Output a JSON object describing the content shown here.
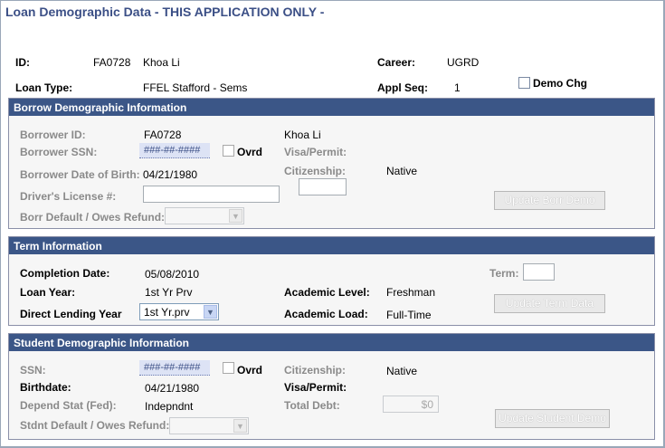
{
  "page": {
    "title": "Loan Demographic Data - THIS APPLICATION ONLY -"
  },
  "header": {
    "id_label": "ID:",
    "id_value": "FA0728",
    "name": "Khoa Li",
    "career_label": "Career:",
    "career_value": "UGRD",
    "loan_type_label": "Loan Type:",
    "loan_type_value": "FFEL Stafford - Sems",
    "appl_seq_label": "Appl Seq:",
    "appl_seq_value": "1",
    "demo_chg_label": "Demo Chg"
  },
  "borrow": {
    "header": "Borrow Demographic Information",
    "borrower_id_label": "Borrower ID:",
    "borrower_id_value": "FA0728",
    "borrower_name": "Khoa Li",
    "ssn_label": "Borrower SSN:",
    "ssn_value": "###-##-####",
    "ovrd_label": "Ovrd",
    "visa_label": "Visa/Permit:",
    "dob_label": "Borrower Date of Birth:",
    "dob_value": "04/21/1980",
    "citizenship_label": "Citizenship:",
    "citizenship_value": "Native",
    "license_label": "Driver's License #:",
    "default_label": "Borr Default / Owes Refund:",
    "update_button": "Update Borr Demo"
  },
  "term": {
    "header": "Term Information",
    "completion_label": "Completion Date:",
    "completion_value": "05/08/2010",
    "term_label": "Term:",
    "loan_year_label": "Loan Year:",
    "loan_year_value": "1st Yr Prv",
    "academic_level_label": "Academic Level:",
    "academic_level_value": "Freshman",
    "direct_lending_label": "Direct Lending Year",
    "direct_lending_value": "1st Yr.prv",
    "academic_load_label": "Academic Load:",
    "academic_load_value": "Full-Time",
    "update_button": "Update Term Data"
  },
  "student": {
    "header": "Student Demographic Information",
    "ssn_label": "SSN:",
    "ssn_value": "###-##-####",
    "ovrd_label": "Ovrd",
    "citizenship_label": "Citizenship:",
    "citizenship_value": "Native",
    "birthdate_label": "Birthdate:",
    "birthdate_value": "04/21/1980",
    "visa_label": "Visa/Permit:",
    "depend_label": "Depend Stat (Fed):",
    "depend_value": "Indepndnt",
    "total_debt_label": "Total Debt:",
    "total_debt_value": "$0",
    "default_label": "Stdnt Default / Owes Refund:",
    "update_button": "Update Student Demo"
  }
}
